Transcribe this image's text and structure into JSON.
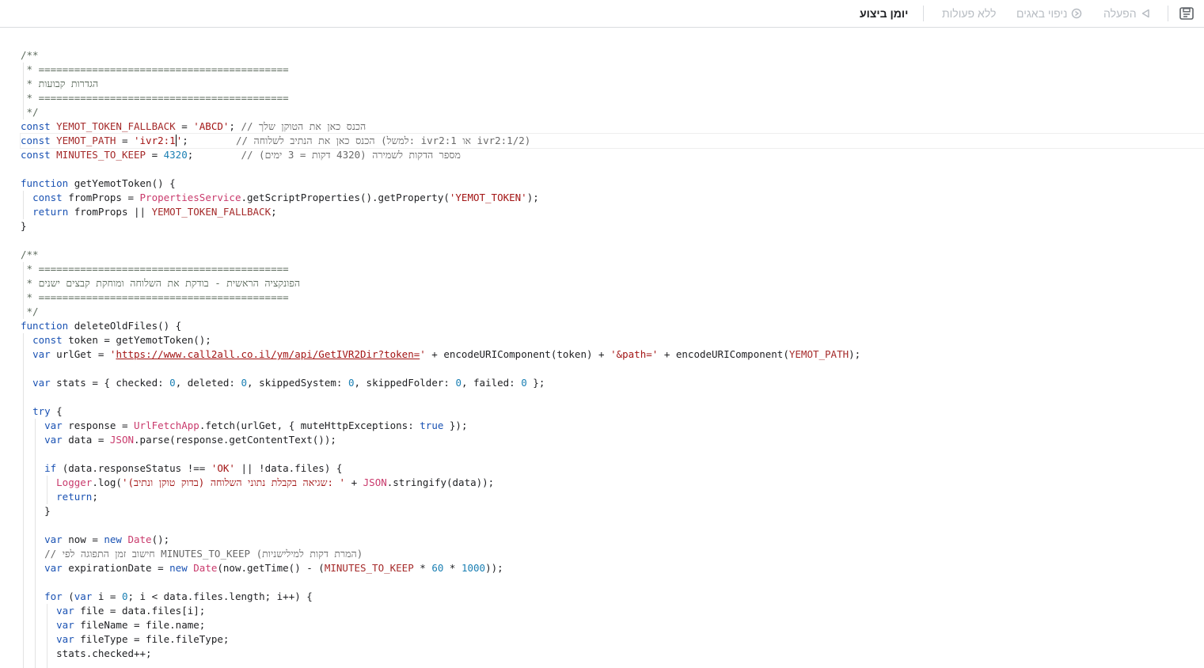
{
  "toolbar": {
    "buttons": [
      {
        "label": "יומן ביצוע",
        "icon": null
      },
      {
        "label": "ללא פעולות",
        "icon": null
      },
      {
        "label": "ניפוי באגים",
        "icon": "debug-icon"
      },
      {
        "label": "הפעלה",
        "icon": "run-triangle-icon"
      }
    ],
    "save_icon": "save-drive-icon"
  },
  "editor": {
    "lines": [
      [
        [
          "cm",
          "/**"
        ]
      ],
      [
        [
          "cm",
          " * =========================================="
        ]
      ],
      [
        [
          "cm",
          " * הגדרות קבועות"
        ]
      ],
      [
        [
          "cm",
          " * =========================================="
        ]
      ],
      [
        [
          "cm",
          " */"
        ]
      ],
      [
        [
          "kw",
          "const "
        ],
        [
          "dec",
          "YEMOT_TOKEN_FALLBACK"
        ],
        [
          "p",
          " = "
        ],
        [
          "str",
          "'ABCD'"
        ],
        [
          "p",
          "; "
        ],
        [
          "cmh",
          "// הכנס כאן את הטוקן שלך"
        ]
      ],
      [
        [
          "kw",
          "const "
        ],
        [
          "dec",
          "YEMOT_PATH"
        ],
        [
          "p",
          " = "
        ],
        [
          "str",
          "'ivr2:1"
        ],
        [
          "cursor",
          ""
        ],
        [
          "str",
          "'"
        ],
        [
          "p",
          ";        "
        ],
        [
          "cmh",
          "// הכנס כאן את הנתיב לשלוחה (למשל: ivr2:1 או ivr2:1/2)"
        ]
      ],
      [
        [
          "kw",
          "const "
        ],
        [
          "dec",
          "MINUTES_TO_KEEP"
        ],
        [
          "p",
          " = "
        ],
        [
          "num",
          "4320"
        ],
        [
          "p",
          ";        "
        ],
        [
          "cmh",
          "// מספר הדקות לשמירה (4320 דקות = 3 ימים)"
        ]
      ],
      [],
      [
        [
          "kw",
          "function "
        ],
        [
          "p",
          "getYemotToken() {"
        ]
      ],
      [
        [
          "p",
          "  "
        ],
        [
          "kw",
          "const "
        ],
        [
          "p",
          "fromProps = "
        ],
        [
          "cl",
          "PropertiesService"
        ],
        [
          "p",
          ".getScriptProperties().getProperty("
        ],
        [
          "str",
          "'YEMOT_TOKEN'"
        ],
        [
          "p",
          ");"
        ]
      ],
      [
        [
          "p",
          "  "
        ],
        [
          "kw",
          "return "
        ],
        [
          "p",
          "fromProps || "
        ],
        [
          "dec",
          "YEMOT_TOKEN_FALLBACK"
        ],
        [
          "p",
          ";"
        ]
      ],
      [
        [
          "p",
          "}"
        ]
      ],
      [],
      [
        [
          "cm",
          "/**"
        ]
      ],
      [
        [
          "cm",
          " * =========================================="
        ]
      ],
      [
        [
          "cm",
          " * הפונקציה הראשית - בודקת את השלוחה ומוחקת קבצים ישנים"
        ]
      ],
      [
        [
          "cm",
          " * =========================================="
        ]
      ],
      [
        [
          "cm",
          " */"
        ]
      ],
      [
        [
          "kw",
          "function "
        ],
        [
          "p",
          "deleteOldFiles() {"
        ]
      ],
      [
        [
          "p",
          "  "
        ],
        [
          "kw",
          "const "
        ],
        [
          "p",
          "token = getYemotToken();"
        ]
      ],
      [
        [
          "p",
          "  "
        ],
        [
          "kw",
          "var "
        ],
        [
          "p",
          "urlGet = "
        ],
        [
          "str",
          "'"
        ],
        [
          "url",
          "https://www.call2all.co.il/ym/api/GetIVR2Dir?token="
        ],
        [
          "str",
          "'"
        ],
        [
          "p",
          " + encodeURIComponent(token) + "
        ],
        [
          "str",
          "'&path='"
        ],
        [
          "p",
          " + encodeURIComponent("
        ],
        [
          "dec",
          "YEMOT_PATH"
        ],
        [
          "p",
          ");"
        ]
      ],
      [],
      [
        [
          "p",
          "  "
        ],
        [
          "kw",
          "var "
        ],
        [
          "p",
          "stats = { checked: "
        ],
        [
          "num",
          "0"
        ],
        [
          "p",
          ", deleted: "
        ],
        [
          "num",
          "0"
        ],
        [
          "p",
          ", skippedSystem: "
        ],
        [
          "num",
          "0"
        ],
        [
          "p",
          ", skippedFolder: "
        ],
        [
          "num",
          "0"
        ],
        [
          "p",
          ", failed: "
        ],
        [
          "num",
          "0"
        ],
        [
          "p",
          " };"
        ]
      ],
      [],
      [
        [
          "p",
          "  "
        ],
        [
          "kw",
          "try "
        ],
        [
          "p",
          "{"
        ]
      ],
      [
        [
          "p",
          "    "
        ],
        [
          "kw",
          "var "
        ],
        [
          "p",
          "response = "
        ],
        [
          "cl",
          "UrlFetchApp"
        ],
        [
          "p",
          ".fetch(urlGet, { muteHttpExceptions: "
        ],
        [
          "kw",
          "true"
        ],
        [
          "p",
          " });"
        ]
      ],
      [
        [
          "p",
          "    "
        ],
        [
          "kw",
          "var "
        ],
        [
          "p",
          "data = "
        ],
        [
          "cl",
          "JSON"
        ],
        [
          "p",
          ".parse(response.getContentText());"
        ]
      ],
      [],
      [
        [
          "p",
          "    "
        ],
        [
          "kw",
          "if "
        ],
        [
          "p",
          "(data.responseStatus !== "
        ],
        [
          "str",
          "'OK'"
        ],
        [
          "p",
          " || !data.files) {"
        ]
      ],
      [
        [
          "p",
          "      "
        ],
        [
          "cl",
          "Logger"
        ],
        [
          "p",
          ".log("
        ],
        [
          "str",
          "'שגיאה בקבלת נתוני השלוחה (בדוק טוקן ונתיב): '"
        ],
        [
          "p",
          " + "
        ],
        [
          "cl",
          "JSON"
        ],
        [
          "p",
          ".stringify(data));"
        ]
      ],
      [
        [
          "p",
          "      "
        ],
        [
          "kw",
          "return"
        ],
        [
          "p",
          ";"
        ]
      ],
      [
        [
          "p",
          "    }"
        ]
      ],
      [],
      [
        [
          "p",
          "    "
        ],
        [
          "kw",
          "var "
        ],
        [
          "p",
          "now = "
        ],
        [
          "kw",
          "new "
        ],
        [
          "cl",
          "Date"
        ],
        [
          "p",
          "();"
        ]
      ],
      [
        [
          "p",
          "    "
        ],
        [
          "cmh",
          "// חישוב זמן התפוגה לפי MINUTES_TO_KEEP (המרת דקות למילישניות)"
        ]
      ],
      [
        [
          "p",
          "    "
        ],
        [
          "kw",
          "var "
        ],
        [
          "p",
          "expirationDate = "
        ],
        [
          "kw",
          "new "
        ],
        [
          "cl",
          "Date"
        ],
        [
          "p",
          "(now.getTime() - ("
        ],
        [
          "dec",
          "MINUTES_TO_KEEP"
        ],
        [
          "p",
          " * "
        ],
        [
          "num",
          "60"
        ],
        [
          "p",
          " * "
        ],
        [
          "num",
          "1000"
        ],
        [
          "p",
          "));"
        ]
      ],
      [],
      [
        [
          "p",
          "    "
        ],
        [
          "kw",
          "for "
        ],
        [
          "p",
          "("
        ],
        [
          "kw",
          "var "
        ],
        [
          "p",
          "i = "
        ],
        [
          "num",
          "0"
        ],
        [
          "p",
          "; i < data.files.length; i++) {"
        ]
      ],
      [
        [
          "p",
          "      "
        ],
        [
          "kw",
          "var "
        ],
        [
          "p",
          "file = data.files[i];"
        ]
      ],
      [
        [
          "p",
          "      "
        ],
        [
          "kw",
          "var "
        ],
        [
          "p",
          "fileName = file.name;"
        ]
      ],
      [
        [
          "p",
          "      "
        ],
        [
          "kw",
          "var "
        ],
        [
          "p",
          "fileType = file.fileType;"
        ]
      ],
      [
        [
          "p",
          "      stats.checked++;"
        ]
      ],
      [
        [
          "p",
          ""
        ]
      ]
    ],
    "active_line": 6
  }
}
